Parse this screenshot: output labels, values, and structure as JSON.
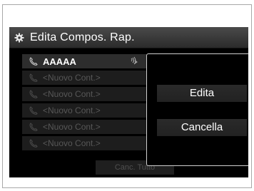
{
  "header": {
    "title": "Edita Compos. Rap.",
    "icon": "settings-gear-icon"
  },
  "list": {
    "items": [
      {
        "label": "AAAAA",
        "state": "active",
        "icon": "phone-icon",
        "trailing_icon": "voice-tag-icon"
      },
      {
        "label": "<Nuovo Cont.>",
        "state": "disabled",
        "icon": "phone-icon"
      },
      {
        "label": "<Nuovo Cont.>",
        "state": "disabled",
        "icon": "phone-icon"
      },
      {
        "label": "<Nuovo Cont.>",
        "state": "disabled",
        "icon": "phone-icon"
      },
      {
        "label": "<Nuovo Cont.>",
        "state": "disabled",
        "icon": "phone-icon"
      },
      {
        "label": "<Nuovo Cont.>",
        "state": "disabled",
        "icon": "phone-icon"
      }
    ]
  },
  "popup": {
    "edit_label": "Edita",
    "delete_label": "Cancella"
  },
  "footer": {
    "cancel_all_label": "Canc. Tutto"
  },
  "colors": {
    "background": "#000000",
    "text": "#ffffff",
    "disabled_text": "#575757",
    "popup_border": "#cfcfcf"
  }
}
